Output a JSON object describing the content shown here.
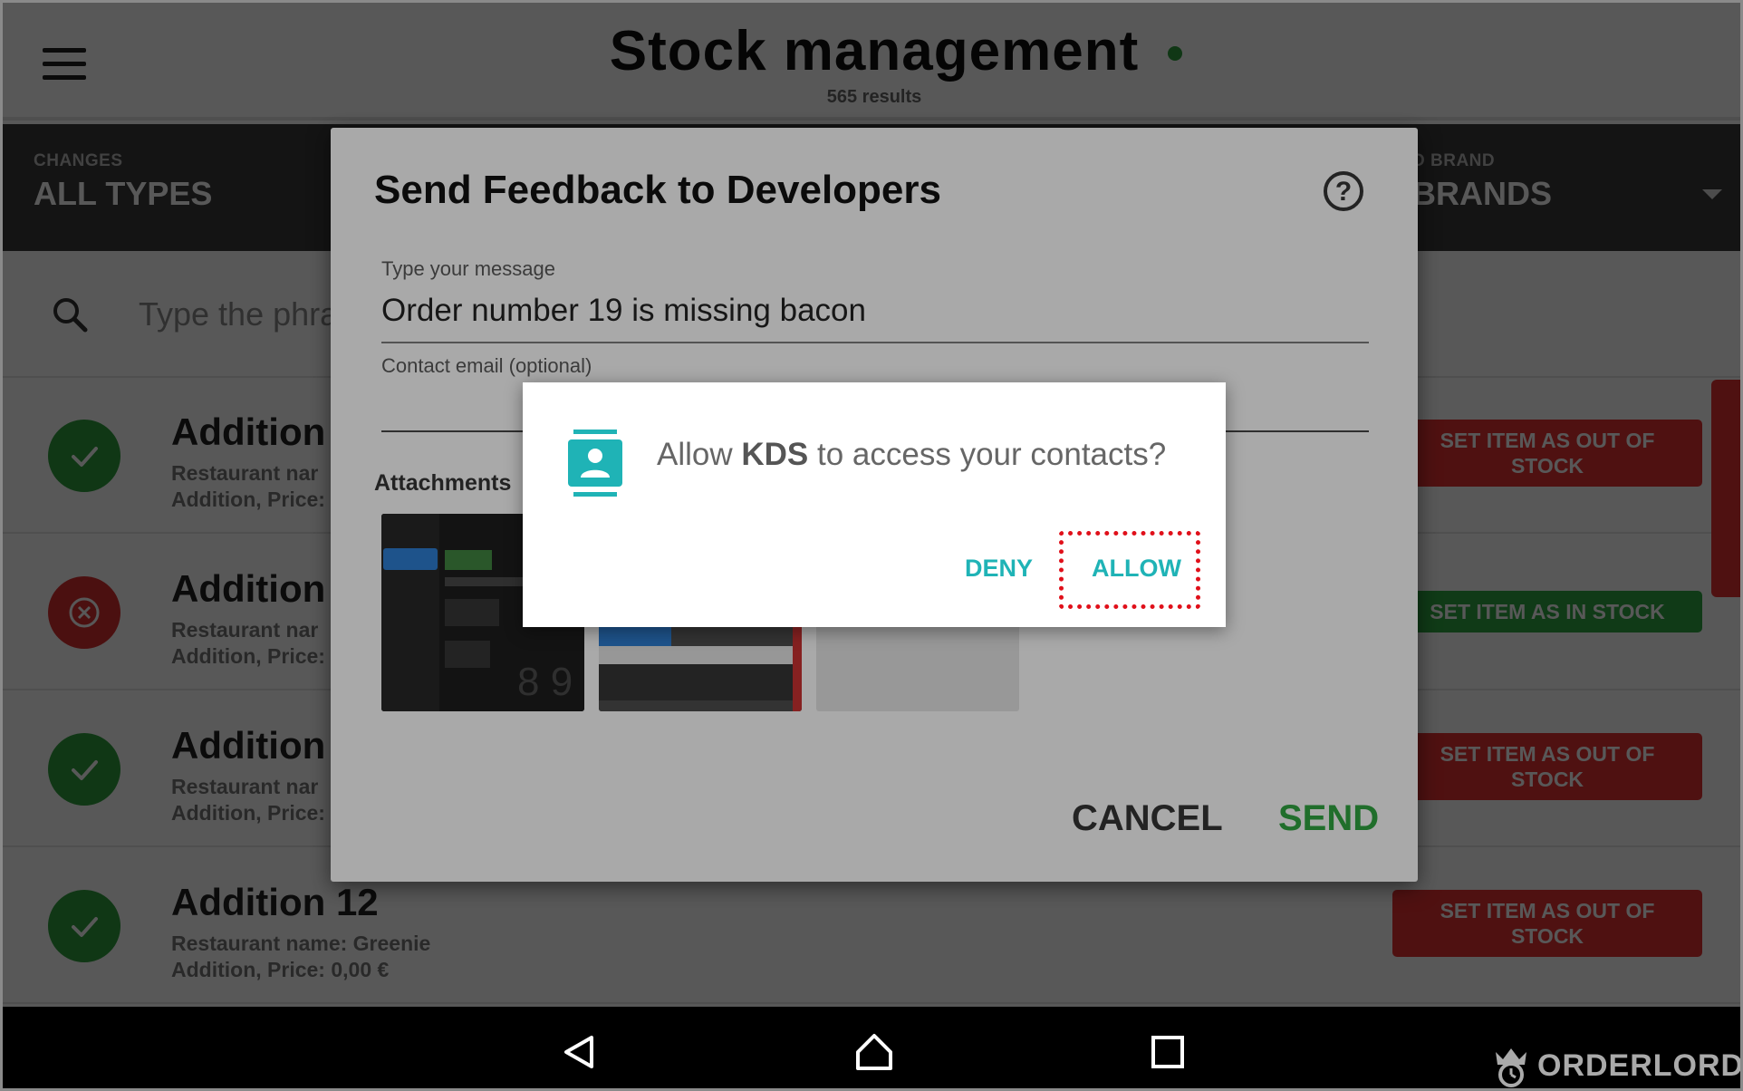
{
  "header": {
    "title": "Stock management",
    "results": "565 results",
    "status_color": "#2e9e3e"
  },
  "filters": {
    "changes_label": "CHANGES",
    "changes_value": "ALL TYPES",
    "brand_label": "D BRAND",
    "brand_value": "BRANDS"
  },
  "search": {
    "placeholder": "Type the phra"
  },
  "list": {
    "items": [
      {
        "title": "Addition",
        "restaurant": "Restaurant nar",
        "detail": "Addition, Price:",
        "status": "in-stock",
        "action": "SET ITEM AS OUT OF STOCK"
      },
      {
        "title": "Addition",
        "restaurant": "Restaurant nar",
        "detail": "Addition, Price:",
        "status": "out-of-stock",
        "action": "SET ITEM AS IN STOCK"
      },
      {
        "title": "Addition",
        "restaurant": "Restaurant nar",
        "detail": "Addition, Price:",
        "status": "in-stock",
        "action": "SET ITEM AS OUT OF STOCK"
      },
      {
        "title": "Addition 12",
        "restaurant": "Restaurant name: Greenie",
        "detail": "Addition, Price: 0,00 €",
        "status": "in-stock",
        "action": "SET ITEM AS OUT OF STOCK"
      }
    ]
  },
  "feedback_dialog": {
    "title": "Send Feedback to Developers",
    "help_icon": "?",
    "message_label": "Type your message",
    "message_value": "Order number 19 is missing bacon",
    "email_label": "Contact email (optional)",
    "attachments_label": "Attachments",
    "cancel_label": "CANCEL",
    "send_label": "SEND"
  },
  "permission_dialog": {
    "prefix": "Allow ",
    "app_name": "KDS",
    "suffix": " to access your contacts?",
    "deny_label": "DENY",
    "allow_label": "ALLOW",
    "accent_color": "#1fb3b6",
    "highlight_color": "#e0101a"
  },
  "brand": {
    "logo_text": "ORDERLORD"
  },
  "colors": {
    "danger": "#e53232",
    "success": "#2ea843",
    "filter_bg": "#3a3a3a"
  }
}
